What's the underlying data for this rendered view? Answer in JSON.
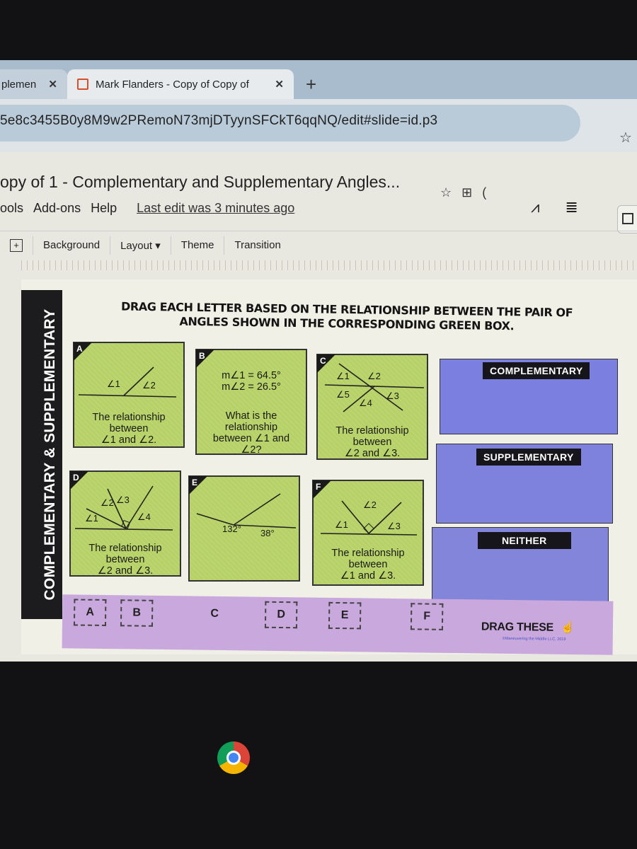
{
  "browser": {
    "tabs": [
      {
        "label": "plemen",
        "active": false
      },
      {
        "label": "Mark Flanders - Copy of Copy of",
        "active": true
      }
    ],
    "tab_close_glyph": "✕",
    "new_tab_glyph": "+",
    "url": "5e8c3455B0y8M9w2PRemoN73mjDTyynSFCkT6qqNQ/edit#slide=id.p3",
    "bookmark_glyph": "☆"
  },
  "slides_app": {
    "doc_title": "opy of 1 - Complementary and Supplementary Angles...",
    "title_icons": {
      "star": "☆",
      "move": "⊞",
      "cloud": "("
    },
    "menu": [
      "ools",
      "Add-ons",
      "Help"
    ],
    "last_edit": "Last edit was 3 minutes ago",
    "right_icons": {
      "activity": "⩘",
      "comments": "≣"
    },
    "toolbar": {
      "add_icon": "+",
      "background": "Background",
      "layout": "Layout ▾",
      "theme": "Theme",
      "transition": "Transition"
    }
  },
  "slide": {
    "sidebar_title": "COMPLEMENTARY & SUPPLEMENTARY",
    "instructions_line1": "DRAG EACH LETTER BASED ON THE RELATIONSHIP BETWEEN THE PAIR OF",
    "instructions_line2": "ANGLES SHOWN IN THE CORRESPONDING GREEN BOX.",
    "cards": {
      "A": {
        "letter": "A",
        "labels": [
          "∠1",
          "∠2"
        ],
        "desc": [
          "The relationship",
          "between",
          "∠1 and ∠2."
        ]
      },
      "B": {
        "letter": "B",
        "m1": "m∠1 = 64.5°",
        "m2": "m∠2 = 26.5°",
        "desc": [
          "What is the",
          "relationship",
          "between ∠1 and",
          "∠2?"
        ]
      },
      "C": {
        "letter": "C",
        "labels": [
          "∠1",
          "∠2",
          "∠5",
          "∠4",
          "∠3"
        ],
        "desc": [
          "The relationship",
          "between",
          "∠2 and ∠3."
        ]
      },
      "D": {
        "letter": "D",
        "labels": [
          "∠2",
          "∠3",
          "∠1",
          "∠4"
        ],
        "desc": [
          "The relationship",
          "between",
          "∠2 and ∠3."
        ]
      },
      "E": {
        "letter": "E",
        "labels": [
          "132°",
          "38°"
        ]
      },
      "F": {
        "letter": "F",
        "labels": [
          "∠2",
          "∠1",
          "∠3"
        ],
        "desc": [
          "The relationship",
          "between",
          "∠1 and ∠3."
        ]
      }
    },
    "drop_zones": [
      "COMPLEMENTARY",
      "SUPPLEMENTARY",
      "NEITHER"
    ],
    "tray": {
      "tiles": [
        "A",
        "B",
        "C",
        "D",
        "E",
        "F"
      ],
      "drag_label": "DRAG THESE",
      "drag_icon": "☝",
      "copyright": "©Maneuvering the Middle LLC, 2019"
    }
  },
  "colors": {
    "card_green": "#b6d166",
    "drop_blue": "#7b7fe0",
    "tray_purple": "#c9a9dd",
    "sidebar_black": "#1c1c1e"
  }
}
